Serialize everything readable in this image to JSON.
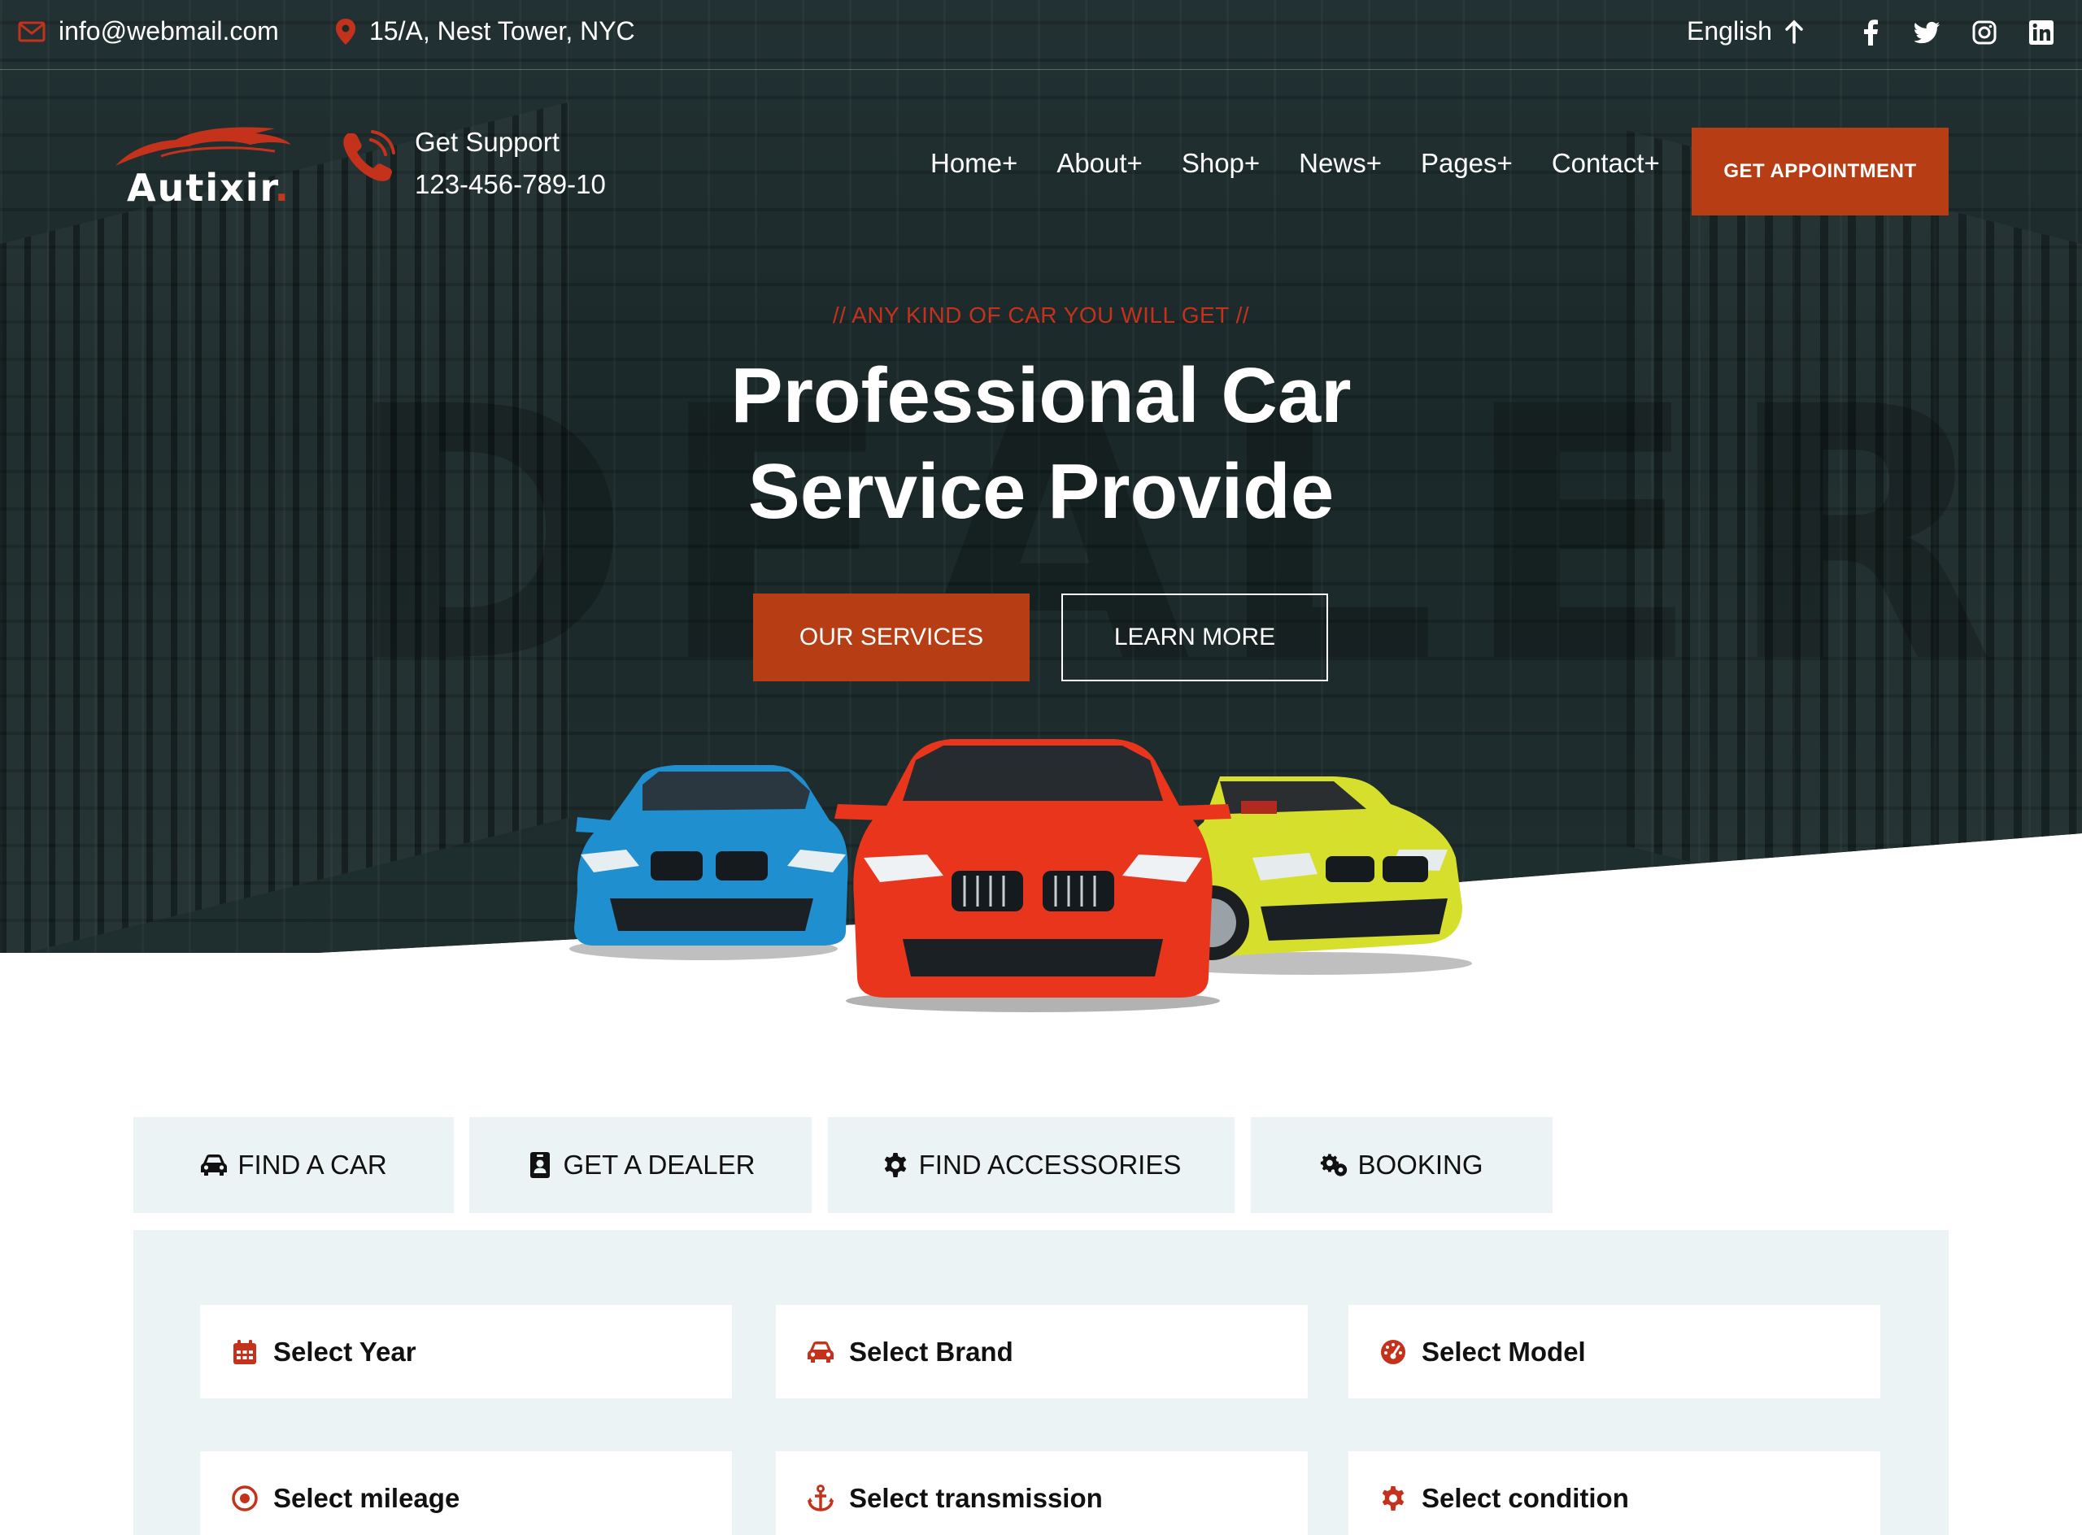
{
  "topbar": {
    "email": "info@webmail.com",
    "address": "15/A, Nest Tower, NYC",
    "language": "English",
    "socials": [
      "facebook-icon",
      "twitter-icon",
      "instagram-icon",
      "linkedin-icon"
    ]
  },
  "header": {
    "logo_text": "Autixir",
    "logo_dot": ".",
    "support_label": "Get Support",
    "support_phone": "123-456-789-10",
    "nav": [
      "Home+",
      "About+",
      "Shop+",
      "News+",
      "Pages+",
      "Contact+"
    ],
    "appointment_button": "GET APPOINTMENT"
  },
  "hero": {
    "subtitle": "// ANY KIND OF CAR YOU WILL GET //",
    "title_line1": "Professional Car",
    "title_line2": "Service Provide",
    "primary_button": "OUR SERVICES",
    "secondary_button": "LEARN MORE"
  },
  "tabs": [
    {
      "label": "FIND A CAR",
      "icon": "car-icon"
    },
    {
      "label": "GET A DEALER",
      "icon": "id-badge-icon"
    },
    {
      "label": "FIND ACCESSORIES",
      "icon": "gear-icon"
    },
    {
      "label": "BOOKING",
      "icon": "gears-icon"
    }
  ],
  "search_fields": [
    {
      "label": "Select Year",
      "icon": "calendar-icon"
    },
    {
      "label": "Select Brand",
      "icon": "car-icon"
    },
    {
      "label": "Select Model",
      "icon": "speedometer-icon"
    },
    {
      "label": "Select mileage",
      "icon": "target-icon"
    },
    {
      "label": "Select transmission",
      "icon": "anchor-icon"
    },
    {
      "label": "Select condition",
      "icon": "gear-icon"
    }
  ],
  "colors": {
    "accent": "#b63d14",
    "accent_text": "#c4321c",
    "hero_bg": "#1c2a2b",
    "panel_bg": "#ecf3f4"
  }
}
